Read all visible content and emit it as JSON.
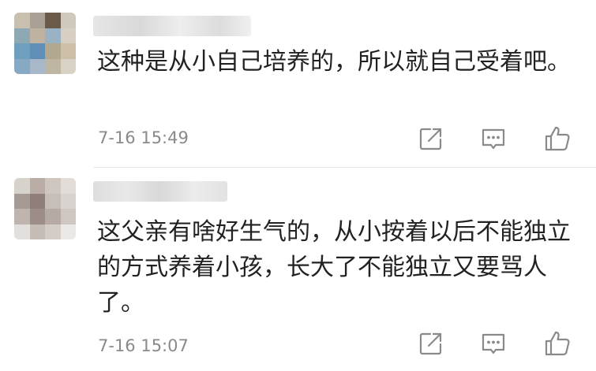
{
  "comments": [
    {
      "text": "这种是从小自己培养的，所以就自己受着吧。",
      "time": "7-16 15:49"
    },
    {
      "text": "这父亲有啥好生气的，从小按着以后不能独立的方式养着小孩，长大了不能独立又要骂人了。",
      "time": "7-16 15:07"
    }
  ],
  "icons": {
    "share": "share-icon",
    "reply": "reply-icon",
    "like": "like-icon"
  }
}
